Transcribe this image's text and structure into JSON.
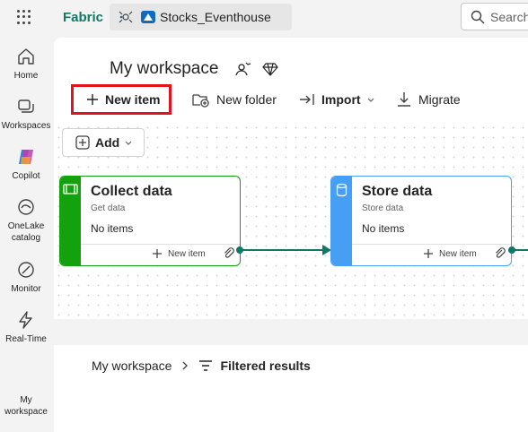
{
  "header": {
    "brand": "Fabric",
    "breadcrumb_item": "Stocks_Eventhouse",
    "search_placeholder": "Search"
  },
  "rail": {
    "items": [
      {
        "label": "Home",
        "icon": "home-icon"
      },
      {
        "label": "Workspaces",
        "icon": "workspaces-icon"
      },
      {
        "label": "Copilot",
        "icon": "copilot-icon"
      },
      {
        "label_line1": "OneLake",
        "label_line2": "catalog",
        "icon": "onelake-icon"
      },
      {
        "label": "Monitor",
        "icon": "monitor-icon"
      },
      {
        "label": "Real-Time",
        "icon": "realtime-icon"
      },
      {
        "label_line1": "My",
        "label_line2": "workspace"
      }
    ]
  },
  "workspace": {
    "title": "My workspace"
  },
  "toolbar": {
    "new_item": "New item",
    "new_folder": "New folder",
    "import": "Import",
    "migrate": "Migrate"
  },
  "canvas": {
    "add_label": "Add",
    "cards": [
      {
        "title": "Collect data",
        "subtitle": "Get data",
        "count": "No items",
        "new_item": "New item",
        "accent": "#13a10e"
      },
      {
        "title": "Store data",
        "subtitle": "Store data",
        "count": "No items",
        "new_item": "New item",
        "accent": "#479ef5"
      }
    ]
  },
  "bottom": {
    "crumb_root": "My workspace",
    "crumb_current": "Filtered results"
  },
  "colors": {
    "brand": "#117865",
    "highlight": "#e0141a"
  }
}
